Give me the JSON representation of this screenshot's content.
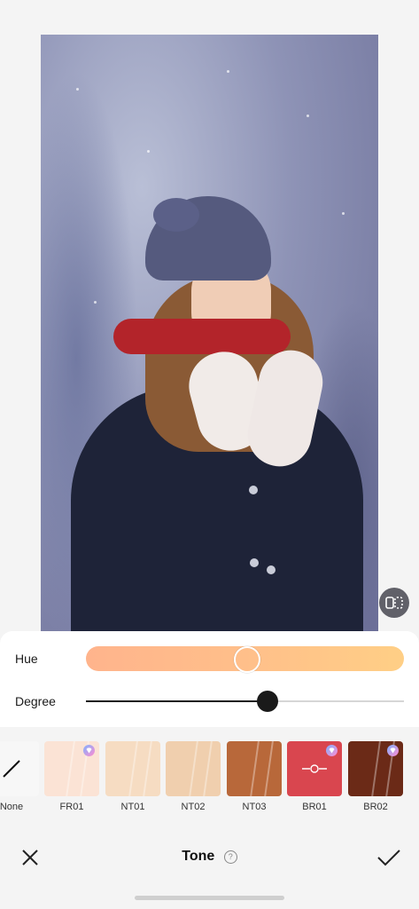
{
  "adjustments": {
    "hue_label": "Hue",
    "degree_label": "Degree",
    "hue_value": 0.5,
    "degree_value": 0.57
  },
  "presets": [
    {
      "label": "None",
      "color": "#f7f7f7",
      "vip": false
    },
    {
      "label": "FR01",
      "color": "#fbe3d5",
      "vip": true
    },
    {
      "label": "NT01",
      "color": "#f6dcc2",
      "vip": false
    },
    {
      "label": "NT02",
      "color": "#f0cfae",
      "vip": false
    },
    {
      "label": "NT03",
      "color": "#b8683a",
      "vip": false
    },
    {
      "label": "BR01",
      "color": "#d9464f",
      "vip": true,
      "selected": true
    },
    {
      "label": "BR02",
      "color": "#6b2a17",
      "vip": true
    }
  ],
  "bottom_bar": {
    "title": "Tone",
    "help_icon": "?"
  },
  "colors": {
    "accent_dark": "#1a1a1a",
    "hue_gradient_start": "#ffb48c",
    "hue_gradient_end": "#ffcf86"
  },
  "icons": {
    "compare": "compare-icon",
    "close": "close-icon",
    "confirm": "checkmark-icon",
    "help": "help-icon",
    "vip": "vip-badge-icon"
  }
}
